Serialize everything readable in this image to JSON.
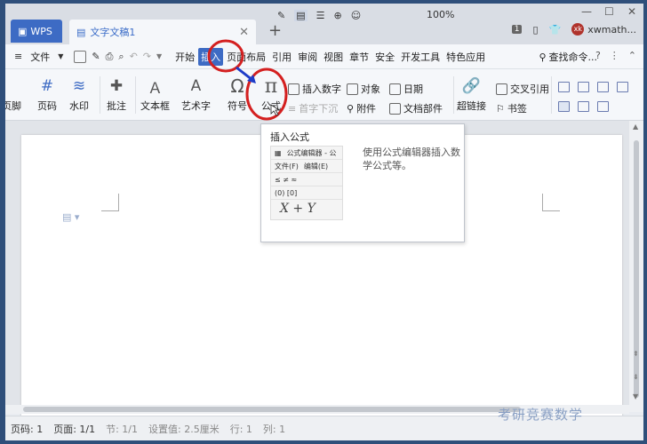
{
  "app": {
    "wps_tab": "WPS",
    "doc_tab": "文字文稿1",
    "add_tab": "+",
    "badge": "1",
    "user": "xwmath...",
    "avatar": "xk"
  },
  "menubar": {
    "file": "文件",
    "menus": [
      "开始",
      "插入",
      "页面布局",
      "引用",
      "审阅",
      "视图",
      "章节",
      "安全",
      "开发工具",
      "特色应用"
    ],
    "active_menu": "插入",
    "search": "查找命令..."
  },
  "ribbon": {
    "footer_partial": "页脚",
    "page_number": "页码",
    "watermark": "水印",
    "comment": "批注",
    "textbox": "文本框",
    "wordart": "艺术字",
    "symbol": "符号",
    "formula": "公式",
    "insert_number": "插入数字",
    "dropcap": "首字下沉",
    "object": "对象",
    "attachment": "附件",
    "date": "日期",
    "doc_parts": "文档部件",
    "hyperlink": "超链接",
    "crossref": "交叉引用",
    "bookmark": "书签"
  },
  "tooltip": {
    "title": "插入公式",
    "description": "使用公式编辑器插入数学公式等。",
    "preview_window": "公式编辑器 - 公",
    "preview_file": "文件(F)",
    "preview_edit": "编辑(E)",
    "preview_row1": "≤ ≠ ≈",
    "preview_row2": "(0) [0]",
    "preview_formula": "X + Y"
  },
  "status": {
    "page_num": "页码: 1",
    "page": "页面: 1/1",
    "section": "节: 1/1",
    "setting": "设置值: 2.5厘米",
    "row": "行: 1",
    "col": "列: 1",
    "zoom": "100%"
  },
  "watermark_text": "考研竞赛数学",
  "colors": {
    "accent": "#3d6bc4",
    "annotation_red": "#d42020",
    "annotation_blue": "#1e3cc8"
  }
}
